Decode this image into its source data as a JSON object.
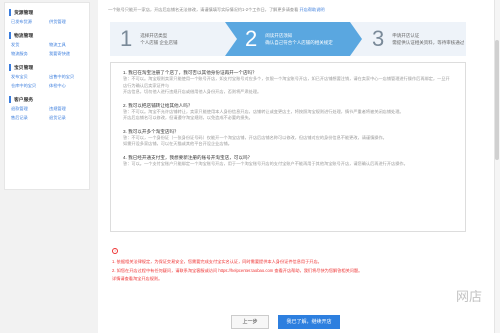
{
  "sidebar": {
    "sections": [
      {
        "title": "货源管理",
        "rows": [
          [
            "已发布货源",
            "供货管理"
          ]
        ]
      },
      {
        "title": "物流管理",
        "rows": [
          [
            "发货",
            "物流工具"
          ],
          [
            "物流服务",
            "我要寄快递"
          ]
        ]
      },
      {
        "title": "宝贝管理",
        "rows": [
          [
            "发布宝贝",
            "出售中的宝贝"
          ],
          [
            "仓库中的宝贝",
            "体检中心"
          ]
        ]
      },
      {
        "title": "客户服务",
        "rows": [
          [
            "退款管理",
            "违规管理"
          ],
          [
            "售后记录",
            "退货记录"
          ]
        ]
      }
    ]
  },
  "topnote": {
    "text": "一个账号只能开一家店，开店后店铺名无法修改，请谨慎填写实际情况约1-2个工作日，了解更多请查看",
    "link": "开店帮助说明"
  },
  "steps": [
    {
      "num": "1",
      "line1": "选择开店类型",
      "line2": "个人店铺 企业店铺"
    },
    {
      "num": "2",
      "line1": "阅读开店须知",
      "line2": "确认自己符合个人店铺的相关规定"
    },
    {
      "num": "3",
      "line1": "申请开店认证",
      "line2": "需提供认证相关资料，等待审核通过"
    }
  ],
  "faq": [
    {
      "q": "1. 我已在淘宝注册了个店了，我可否以其他身份证再开一个店吗？",
      "a1": "答：不可以。淘宝规则卖家只能使用一个账号开店，如支付宝账号对应多个，仅限一个淘宝账号开店，如已开店铺想要注销，请在卖家中心—店铺管理进行操作后再绑定，一旦开店行为确认后卖家证件与",
      "a2": "开店信息，切勿他人进行违规开店或借用他人身份开店，否则将严肃处理。"
    },
    {
      "q": "2. 我可以把店铺转让给其他人吗？",
      "a1": "答：不可以。淘宝不允许店铺转让，卖家只能使用本人身份信息开店，店铺转让或变更店主，将按照淘宝规则进行处理，情节严重者将被关闭店铺处理。",
      "a2": "开店后店铺名可以修改，但请遵守淘宝规则，以免造成不必要的损失。"
    },
    {
      "q": "3. 我可以开多个淘宝店吗？",
      "a1": "答：不可以，一个身份证（一张身份证号码）仅能开一个淘宝店铺，开店后店铺名称可以修改，但店铺对应的身份信息不能更改，请谨慎操作。",
      "a2": "如需开设多家店铺，可以在天猫或其他平台开设企业店铺。"
    },
    {
      "q": "4. 我已经开通支付宝，我想要新注册的账号开淘宝店，可以吗？",
      "a1": "答：可以。一个支付宝账户只能绑定一个淘宝账号开店，用于一个淘宝账号开店的支付宝账户不能再用于其他淘宝账号开店，请您确认后再进行开店操作。",
      "a2": ""
    }
  ],
  "warnings": [
    "1. 依据相关法律规定，为保证交易安全，您需要完成支付宝实名认证，同时需要提供本人身份证件信息用于开店。",
    "2. 如您在开店过程中有任何疑问，请联系淘宝客服或访问 https://helpcenter.taobao.com 查看开店帮助，我们将尽快为您解答相关问题。",
    "详情请查看淘宝开店规则。"
  ],
  "buttons": {
    "back": "上一步",
    "go": "我已了解，继续开店"
  },
  "watermark": "网店"
}
